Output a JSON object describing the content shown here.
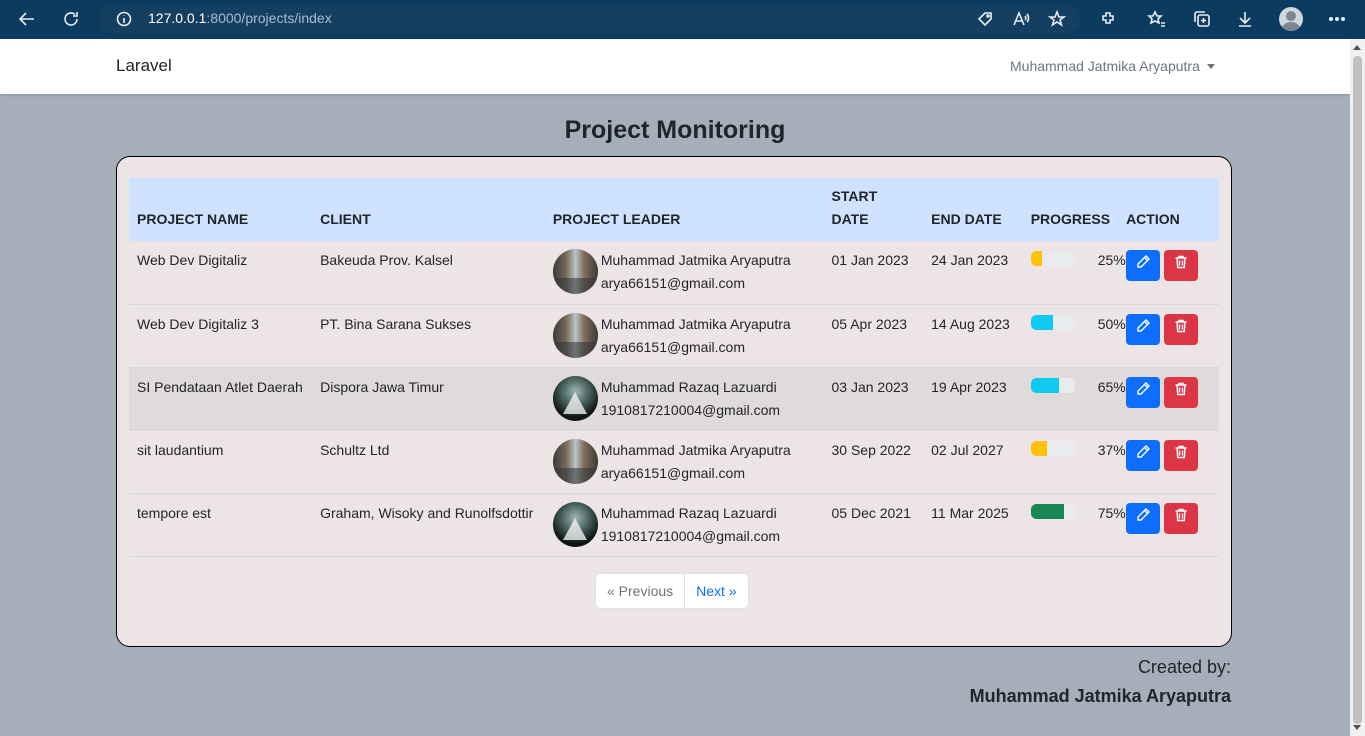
{
  "browser": {
    "url_host": "127.0.0.1",
    "url_path": ":8000/projects/index"
  },
  "navbar": {
    "brand": "Laravel",
    "user": "Muhammad Jatmika Aryaputra"
  },
  "page": {
    "title": "Project Monitoring"
  },
  "table": {
    "headers": {
      "project_name": "PROJECT NAME",
      "client": "CLIENT",
      "project_leader": "PROJECT LEADER",
      "start_date": "START DATE",
      "end_date": "END DATE",
      "progress": "PROGRESS",
      "action": "ACTION"
    },
    "rows": [
      {
        "project_name": "Web Dev Digitaliz",
        "client": "Bakeuda Prov. Kalsel",
        "leader_name": "Muhammad Jatmika Aryaputra",
        "leader_email": "arya66151@gmail.com",
        "start_date": "01 Jan 2023",
        "end_date": "24 Jan 2023",
        "progress_label": "25%",
        "progress": 0.25,
        "progress_color": "#ffc107",
        "avatar": "street-photo"
      },
      {
        "project_name": "Web Dev Digitaliz 3",
        "client": "PT. Bina Sarana Sukses",
        "leader_name": "Muhammad Jatmika Aryaputra",
        "leader_email": "arya66151@gmail.com",
        "start_date": "05 Apr 2023",
        "end_date": "14 Aug 2023",
        "progress_label": "50%",
        "progress": 0.5,
        "progress_color": "#0dcaf0",
        "avatar": "street-photo"
      },
      {
        "project_name": "SI Pendataan Atlet Daerah",
        "client": "Dispora Jawa Timur",
        "leader_name": "Muhammad Razaq Lazuardi",
        "leader_email": "1910817210004@gmail.com",
        "start_date": "03 Jan 2023",
        "end_date": "19 Apr 2023",
        "progress_label": "65%",
        "progress": 0.65,
        "progress_color": "#0dcaf0",
        "avatar": "dark-photo"
      },
      {
        "project_name": "sit laudantium",
        "client": "Schultz Ltd",
        "leader_name": "Muhammad Jatmika Aryaputra",
        "leader_email": "arya66151@gmail.com",
        "start_date": "30 Sep 2022",
        "end_date": "02 Jul 2027",
        "progress_label": "37%",
        "progress": 0.37,
        "progress_color": "#ffc107",
        "avatar": "street-photo"
      },
      {
        "project_name": "tempore est",
        "client": "Graham, Wisoky and Runolfsdottir",
        "leader_name": "Muhammad Razaq Lazuardi",
        "leader_email": "1910817210004@gmail.com",
        "start_date": "05 Dec 2021",
        "end_date": "11 Mar 2025",
        "progress_label": "75%",
        "progress": 0.75,
        "progress_color": "#198754",
        "avatar": "dark-photo"
      }
    ]
  },
  "pagination": {
    "previous": "« Previous",
    "next": "Next »"
  },
  "footer": {
    "label": "Created by:",
    "name": "Muhammad Jatmika Aryaputra"
  },
  "icons": {
    "edit": "pencil-icon",
    "delete": "trash-icon"
  }
}
